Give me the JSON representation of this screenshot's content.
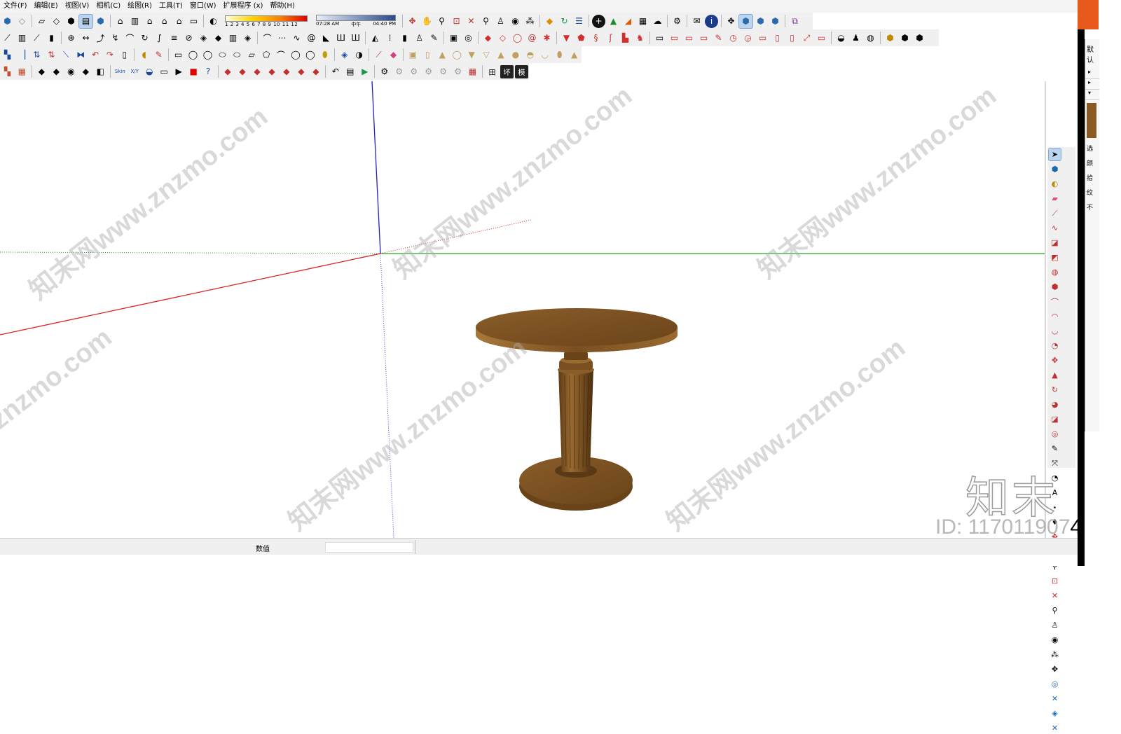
{
  "menu": [
    "文件(F)",
    "编辑(E)",
    "视图(V)",
    "相机(C)",
    "绘图(R)",
    "工具(T)",
    "窗口(W)",
    "扩展程序 (x)",
    "帮助(H)"
  ],
  "toolbar": {
    "shadow_months": "1 2 3 4 5 6 7 8 9 10 11 12",
    "time_start": "07:28 AM",
    "time_noon": "中午",
    "time_end": "04:40 PM",
    "row4_text_buttons": [
      "Skin",
      "X/Y",
      "田",
      "坏",
      "模"
    ]
  },
  "status": {
    "value_label": "数值"
  },
  "tray": {
    "title": "默认",
    "glyphs": [
      "选",
      "颜",
      "拾",
      "纹",
      "不"
    ]
  },
  "watermarks": {
    "site_text": "知末网www.znzmo.com",
    "short_text": "znzmo.com",
    "logo": "知末",
    "id_prefix": "ID: 117011907",
    "id_last": "4"
  },
  "colors": {
    "x_axis": "#dd2020",
    "y_axis": "#22aa22",
    "z_axis": "#2020cc",
    "wood": "#8a5a22",
    "toolbar_bg": "#f0f0f0"
  },
  "icons": {
    "row1": [
      "select-icon",
      "eraser-icon",
      "face-icon",
      "component-icon",
      "paint-icon",
      "layers-icon",
      "model-icon",
      "house-icon",
      "iso-icon",
      "top-icon",
      "front-icon",
      "right-icon",
      "shadow-icon",
      "orbit-icon",
      "pan-icon",
      "zoom-icon",
      "zoom-window-icon",
      "zoom-extents-icon",
      "walk-icon",
      "look-icon",
      "footprints-icon",
      "section-icon",
      "refresh-icon",
      "export-icon",
      "plus-icon",
      "tree-icon",
      "stairs-icon",
      "checker-icon",
      "cloud-icon",
      "gear-icon",
      "mail-icon",
      "info-icon",
      "move-icon",
      "view-a-icon",
      "view-b-icon",
      "view-c-icon",
      "plugin-icon"
    ]
  }
}
